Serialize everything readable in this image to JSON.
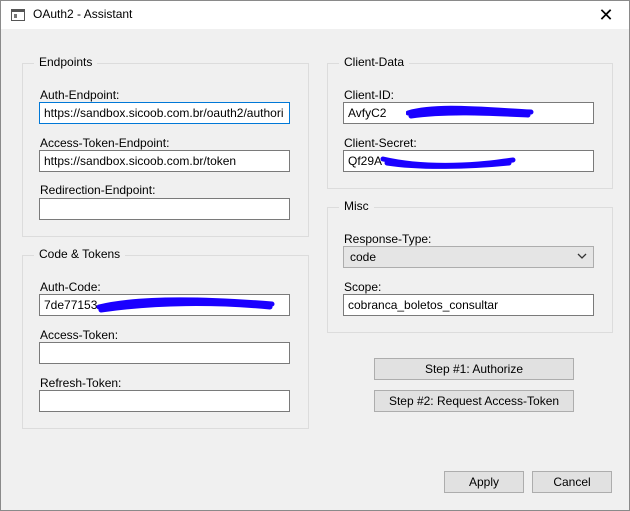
{
  "window": {
    "title": "OAuth2 - Assistant",
    "close_glyph": "✕"
  },
  "endpoints": {
    "title": "Endpoints",
    "auth_label": "Auth-Endpoint:",
    "auth_value": "https://sandbox.sicoob.com.br/oauth2/authori",
    "token_label": "Access-Token-Endpoint:",
    "token_value": "https://sandbox.sicoob.com.br/token",
    "redirect_label": "Redirection-Endpoint:",
    "redirect_value": ""
  },
  "client_data": {
    "title": "Client-Data",
    "id_label": "Client-ID:",
    "id_value": "AvfyC2",
    "secret_label": "Client-Secret:",
    "secret_value": "Qf29A"
  },
  "misc": {
    "title": "Misc",
    "response_label": "Response-Type:",
    "response_value": "code",
    "scope_label": "Scope:",
    "scope_value": "cobranca_boletos_consultar"
  },
  "code_tokens": {
    "title": "Code & Tokens",
    "auth_code_label": "Auth-Code:",
    "auth_code_value": "7de77153-",
    "access_label": "Access-Token:",
    "access_value": "",
    "refresh_label": "Refresh-Token:",
    "refresh_value": ""
  },
  "actions": {
    "authorize": "Step #1: Authorize",
    "request_token": "Step #2: Request Access-Token",
    "apply": "Apply",
    "cancel": "Cancel"
  },
  "icons": {
    "app_icon": "window-icon",
    "combo_icon": "chevron-down-icon",
    "redaction_color": "#1a00ff"
  }
}
